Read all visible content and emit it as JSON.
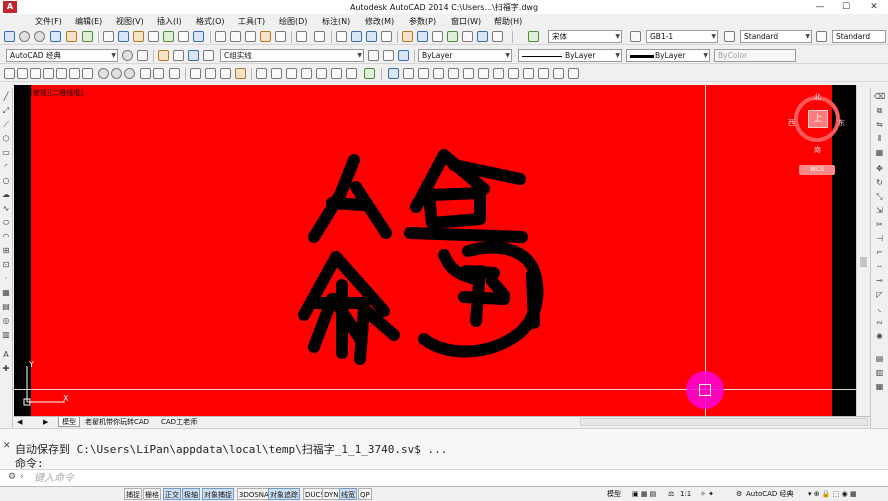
{
  "window": {
    "app_logo": "A",
    "title": "Autodesk AutoCAD 2014    C:\\Users...\\扫福字.dwg",
    "min_glyph": "—",
    "max_glyph": "☐",
    "close_glyph": "✕"
  },
  "menu": {
    "items": [
      "文件(F)",
      "编辑(E)",
      "视图(V)",
      "插入(I)",
      "格式(O)",
      "工具(T)",
      "绘图(D)",
      "标注(N)",
      "修改(M)",
      "参数(P)",
      "窗口(W)",
      "帮助(H)"
    ]
  },
  "toolbar_top": {
    "font_combo": "宋体",
    "dimstyle_combo": "GB1-1",
    "textstyle_combo": "Standard",
    "tablestyle_combo": "Standard"
  },
  "toolbar_mid": {
    "workspace_combo": "AutoCAD 经典",
    "layer_combo": "C组实线",
    "color_combo": "ByLayer",
    "linetype_combo": "ByLayer",
    "lineweight_combo": "ByLayer",
    "plotstyle_combo": "ByColor"
  },
  "viewport": {
    "label": "[俯视][二维线框]",
    "background_color": "#fe0000",
    "glyph_color": "#000000"
  },
  "viewcube": {
    "north": "北",
    "south": "南",
    "east": "东",
    "west": "西",
    "top": "上",
    "wcs": "WCS"
  },
  "ucs": {
    "y_label": "Y",
    "x_label": "X"
  },
  "tabs": {
    "model": "模型",
    "layout1": "老翟机带你玩转CAD",
    "layout2": "CAD工老师",
    "nav_prev": "◀",
    "nav_next": "▶"
  },
  "command": {
    "history": "自动保存到 C:\\Users\\LiPan\\appdata\\local\\temp\\扫福字_1_1_3740.sv$ ...",
    "prompt": "命令:",
    "placeholder": "键入命令",
    "close_glyph": "✕"
  },
  "status": {
    "buttons": [
      "捕捉",
      "栅格",
      "正交",
      "极轴",
      "对象捕捉",
      "3DOSNAP",
      "对象追踪",
      "DUCS",
      "DYN",
      "线宽",
      "QP"
    ],
    "active": [
      "正交",
      "极轴",
      "对象捕捉",
      "对象追踪",
      "线宽"
    ],
    "model_label": "模型",
    "scale": "1:1",
    "workspace": "AutoCAD 经典"
  }
}
